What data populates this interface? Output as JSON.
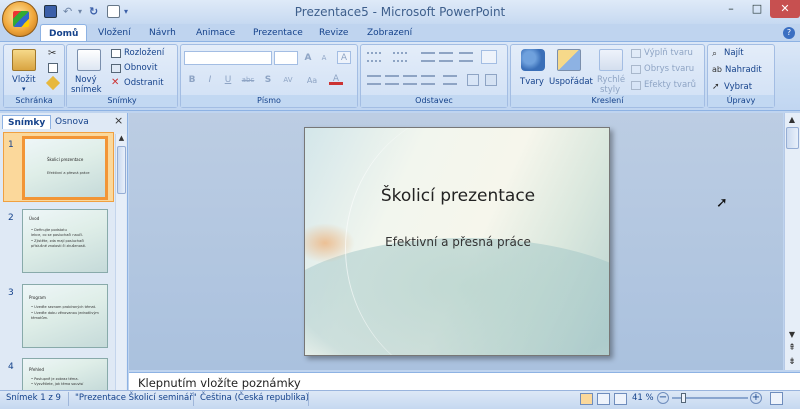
{
  "window": {
    "title": "Prezentace5 - Microsoft PowerPoint",
    "controls": [
      "–",
      "□",
      "✕"
    ]
  },
  "tabs": [
    "Domů",
    "Vložení",
    "Návrh",
    "Animace",
    "Prezentace",
    "Revize",
    "Zobrazení"
  ],
  "ribbon": {
    "clipboard": {
      "paste": "Vložit",
      "label": "Schránka"
    },
    "slides": {
      "new_slide_1": "Nový",
      "new_slide_2": "snímek",
      "layout": "Rozložení",
      "reset": "Obnovit",
      "delete": "Odstranit",
      "label": "Snímky"
    },
    "font": {
      "label": "Písmo",
      "bold": "B",
      "italic": "I",
      "underline": "U",
      "strike": "abc",
      "shadow": "S",
      "spacing": "AV",
      "case": "Aa",
      "grow": "A",
      "shrink": "A",
      "clear": "A"
    },
    "paragraph": {
      "label": "Odstavec"
    },
    "drawing": {
      "shapes": "Tvary",
      "arrange": "Uspořádat",
      "quick_1": "Rychlé",
      "quick_2": "styly",
      "fill": "Výplň tvaru",
      "outline": "Obrys tvaru",
      "effects": "Efekty tvarů",
      "label": "Kreslení"
    },
    "editing": {
      "find": "Najít",
      "replace": "Nahradit",
      "select": "Vybrat",
      "label": "Úpravy"
    }
  },
  "panel": {
    "tab_slides": "Snímky",
    "tab_outline": "Osnova",
    "close": "×",
    "thumbs": [
      {
        "num": "1",
        "title": "Školicí prezentace",
        "lines": [
          "Efektivní a přesná práce"
        ]
      },
      {
        "num": "2",
        "title": "Úvod",
        "lines": [
          "• Definujte podstatu",
          "  lekce, co se posluchači naučí.",
          "• Zjistěte, zda mají posluchači",
          "  příslušné znalosti či zkušenosti."
        ]
      },
      {
        "num": "3",
        "title": "Program",
        "lines": [
          "• Uveďte seznam probíraných témat.",
          "• Uveďte dobu věnovanou jednotlivým",
          "  tématům."
        ]
      },
      {
        "num": "4",
        "title": "Přehled",
        "lines": [
          "• Postupně je zobraz téma.",
          "• Vysvětlete, jak téma souvisí"
        ]
      }
    ]
  },
  "slide": {
    "title": "Školicí prezentace",
    "subtitle": "Efektivní a přesná práce"
  },
  "notes": {
    "placeholder": "Klepnutím vložíte poznámky"
  },
  "status": {
    "slide_info": "Snímek 1 z 9",
    "theme": "\"Prezentace Školicí seminář\"",
    "language": "Čeština (Česká republika)",
    "zoom": "41 %"
  }
}
